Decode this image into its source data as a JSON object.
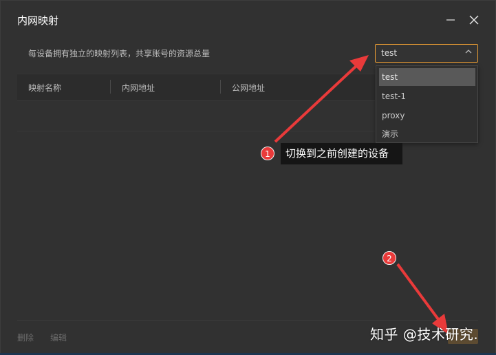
{
  "window": {
    "title": "内网映射",
    "minimize_icon": "minimize-icon",
    "close_icon": "close-icon"
  },
  "hint_text": "每设备拥有独立的映射列表，共享账号的资源总量",
  "device_select": {
    "value": "test",
    "arrow_icon": "chevron-up-icon",
    "options": [
      "test",
      "test-1",
      "proxy",
      "演示"
    ],
    "selected_index": 0,
    "accent": "#e59a33"
  },
  "table": {
    "columns": [
      "映射名称",
      "内网地址",
      "公网地址"
    ]
  },
  "annotations": {
    "badge1": "1",
    "tooltip": "切换到之前创建的设备",
    "badge2": "2",
    "arrow_color": "#e93a3a"
  },
  "footer": {
    "delete_label": "删除",
    "edit_label": "编辑"
  },
  "watermark": "知乎 @技术研究."
}
